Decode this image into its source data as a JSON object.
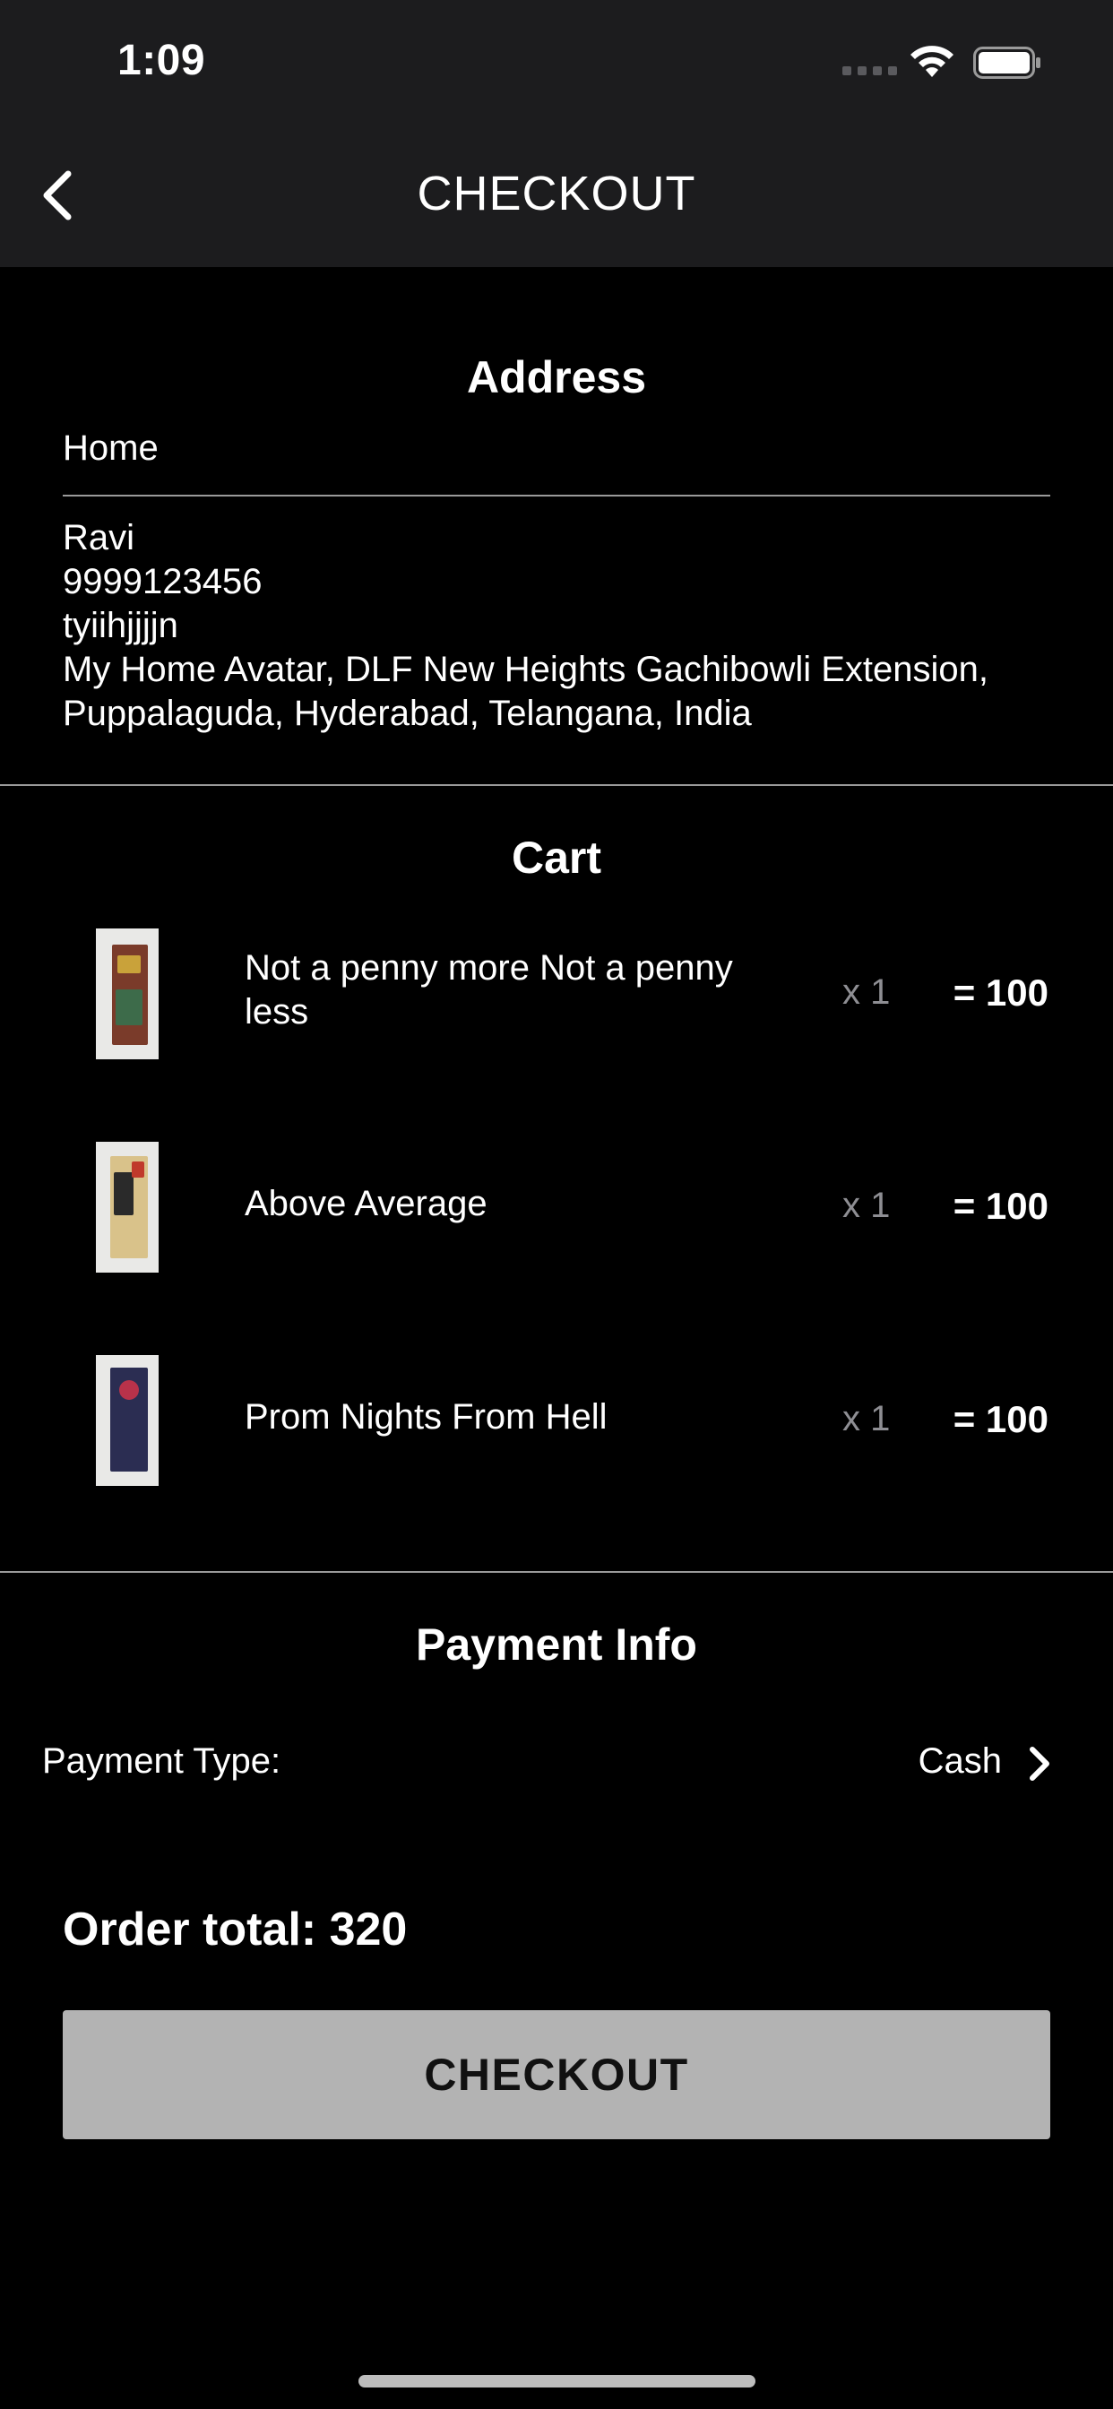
{
  "status_bar": {
    "time": "1:09",
    "icons": [
      "signal-dots-icon",
      "wifi-icon",
      "battery-icon"
    ]
  },
  "nav": {
    "title": "CHECKOUT",
    "back_icon": "chevron-left-icon"
  },
  "address": {
    "heading": "Address",
    "label": "Home",
    "lines": [
      "Ravi",
      "9999123456",
      "tyiihjjjjn",
      "My Home Avatar, DLF New Heights Gachibowli Extension,",
      "Puppalaguda, Hyderabad, Telangana, India"
    ]
  },
  "cart": {
    "heading": "Cart",
    "items": [
      {
        "name": "Not a penny more Not a penny less",
        "qty": "x 1",
        "total": "= 100"
      },
      {
        "name": "Above Average",
        "qty": "x 1",
        "total": "= 100"
      },
      {
        "name": "Prom Nights From Hell",
        "qty": "x 1",
        "total": "= 100"
      }
    ]
  },
  "payment": {
    "heading": "Payment Info",
    "type_label": "Payment Type:",
    "type_value": "Cash",
    "chevron_icon": "chevron-right-icon"
  },
  "order": {
    "total_label": "Order total:",
    "total_value": "320"
  },
  "checkout_button": {
    "label": "CHECKOUT"
  },
  "colors": {
    "background": "#000000",
    "nav_background": "#1c1c1e",
    "divider": "#9a9a9a",
    "button": "#b3b3b3",
    "qty_text": "#8e8e93"
  }
}
